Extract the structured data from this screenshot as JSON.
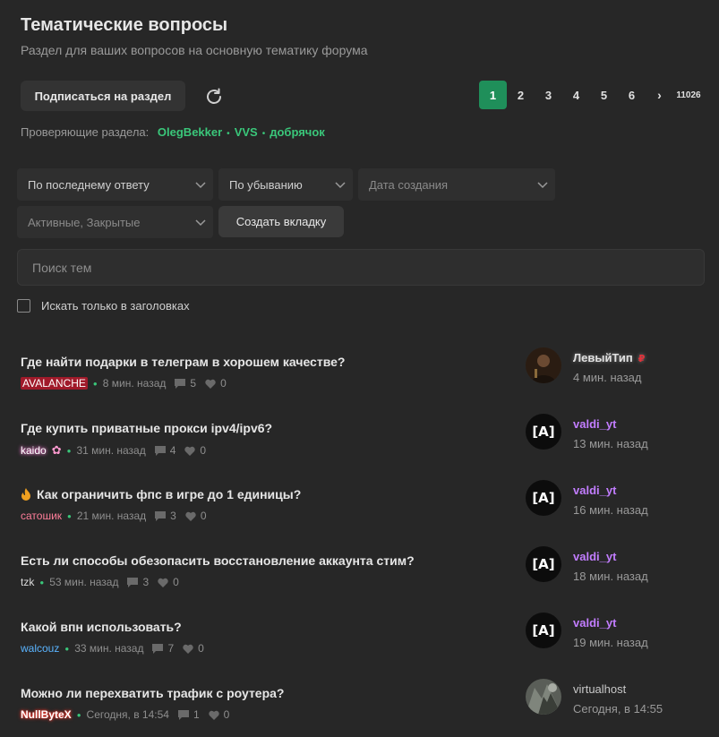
{
  "header": {
    "title": "Тематические вопросы",
    "subtitle": "Раздел для ваших вопросов на основную тематику форума"
  },
  "toolbar": {
    "subscribe_label": "Подписаться на раздел"
  },
  "pagination": {
    "pages": [
      "1",
      "2",
      "3",
      "4",
      "5",
      "6"
    ],
    "next": "›",
    "last": "11026",
    "current": "1"
  },
  "reviewers": {
    "label": "Проверяющие раздела:",
    "names": [
      "OlegBekker",
      "VVS",
      "добрячок"
    ]
  },
  "filters": {
    "sort": "По последнему ответу",
    "order": "По убыванию",
    "date": "Дата создания",
    "status": "Активные, Закрытые",
    "create_tab": "Создать вкладку"
  },
  "search": {
    "placeholder": "Поиск тем",
    "titles_only": "Искать только в заголовках"
  },
  "threads": [
    {
      "title": "Где найти подарки в телеграм в хорошем качестве?",
      "author": "AVALANCHE",
      "time": "8 мин. назад",
      "replies": "5",
      "likes": "0",
      "last_user": "ЛевыйТип",
      "last_time": "4 мин. назад"
    },
    {
      "title": "Где купить приватные прокси ipv4/ipv6?",
      "author": "kaido",
      "time": "31 мин. назад",
      "replies": "4",
      "likes": "0",
      "last_user": "valdi_yt",
      "last_time": "13 мин. назад"
    },
    {
      "title": "Как ограничить фпс в игре до 1 единицы?",
      "author": "сатошик",
      "time": "21 мин. назад",
      "replies": "3",
      "likes": "0",
      "last_user": "valdi_yt",
      "last_time": "16 мин. назад"
    },
    {
      "title": "Есть ли способы обезопасить восстановление аккаунта стим?",
      "author": "tzk",
      "time": "53 мин. назад",
      "replies": "3",
      "likes": "0",
      "last_user": "valdi_yt",
      "last_time": "18 мин. назад"
    },
    {
      "title": "Какой впн использовать?",
      "author": "walcouz",
      "time": "33 мин. назад",
      "replies": "7",
      "likes": "0",
      "last_user": "valdi_yt",
      "last_time": "19 мин. назад"
    },
    {
      "title": "Можно ли перехватить трафик с роутера?",
      "author": "NullByteX",
      "time": "Сегодня, в 14:54",
      "replies": "1",
      "likes": "0",
      "last_user": "virtualhost",
      "last_time": "Сегодня, в 14:55"
    }
  ],
  "avatar_text": "[A]",
  "colors": {
    "background": "#272727",
    "accent_green": "#1f8f5a",
    "moderator": "#3ac77a",
    "valdi": "#c27dff"
  },
  "icons": {
    "refresh": "refresh-icon",
    "fire": "fire-icon",
    "sakura": "sakura-icon",
    "replies": "comment-icon",
    "likes": "heart-icon",
    "ruble": "ruble-icon"
  }
}
